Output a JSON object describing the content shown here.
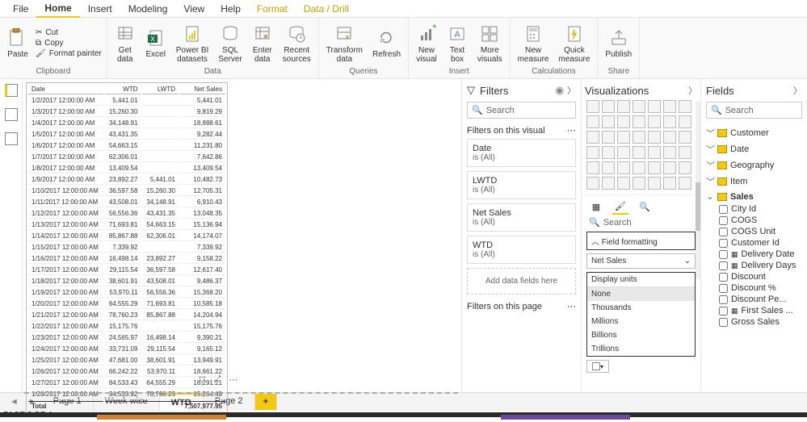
{
  "menubar": [
    "File",
    "Home",
    "Insert",
    "Modeling",
    "View",
    "Help",
    "Format",
    "Data / Drill"
  ],
  "menubar_active": 1,
  "menubar_yellow": [
    6,
    7
  ],
  "ribbon": {
    "clipboard": {
      "label": "Clipboard",
      "paste": "Paste",
      "cut": "Cut",
      "copy": "Copy",
      "fmtpainter": "Format painter"
    },
    "data": {
      "label": "Data",
      "get": "Get\ndata",
      "excel": "Excel",
      "pbi": "Power BI\ndatasets",
      "sql": "SQL\nServer",
      "enter": "Enter\ndata",
      "recent": "Recent\nsources"
    },
    "queries": {
      "label": "Queries",
      "transform": "Transform\ndata",
      "refresh": "Refresh"
    },
    "insert": {
      "label": "Insert",
      "newvis": "New\nvisual",
      "textbox": "Text\nbox",
      "more": "More\nvisuals"
    },
    "calc": {
      "label": "Calculations",
      "newmeas": "New\nmeasure",
      "quick": "Quick\nmeasure"
    },
    "share": {
      "label": "Share",
      "publish": "Publish"
    }
  },
  "table": {
    "columns": [
      "Date",
      "WTD",
      "LWTD",
      "Net Sales"
    ],
    "rows": [
      [
        "1/2/2017 12:00:00 AM",
        "5,441.01",
        "",
        "5,441.01"
      ],
      [
        "1/3/2017 12:00:00 AM",
        "15,260.30",
        "",
        "9,819.29"
      ],
      [
        "1/4/2017 12:00:00 AM",
        "34,148.91",
        "",
        "18,888.61"
      ],
      [
        "1/5/2017 12:00:00 AM",
        "43,431.35",
        "",
        "9,282.44"
      ],
      [
        "1/6/2017 12:00:00 AM",
        "54,663.15",
        "",
        "11,231.80"
      ],
      [
        "1/7/2017 12:00:00 AM",
        "62,306.01",
        "",
        "7,642.86"
      ],
      [
        "1/8/2017 12:00:00 AM",
        "13,409.54",
        "",
        "13,409.54"
      ],
      [
        "1/9/2017 12:00:00 AM",
        "23,892.27",
        "5,441.01",
        "10,482.73"
      ],
      [
        "1/10/2017 12:00:00 AM",
        "36,597.58",
        "15,260.30",
        "12,705.31"
      ],
      [
        "1/11/2017 12:00:00 AM",
        "43,508.01",
        "34,148.91",
        "6,910.43"
      ],
      [
        "1/12/2017 12:00:00 AM",
        "56,556.36",
        "43,431.35",
        "13,048.35"
      ],
      [
        "1/13/2017 12:00:00 AM",
        "71,693.81",
        "54,663.15",
        "15,136.94"
      ],
      [
        "1/14/2017 12:00:00 AM",
        "85,867.88",
        "62,306.01",
        "14,174.07"
      ],
      [
        "1/15/2017 12:00:00 AM",
        "7,339.92",
        "",
        "7,339.92"
      ],
      [
        "1/16/2017 12:00:00 AM",
        "16,498.14",
        "23,892.27",
        "9,158.22"
      ],
      [
        "1/17/2017 12:00:00 AM",
        "29,115.54",
        "36,597.58",
        "12,617.40"
      ],
      [
        "1/18/2017 12:00:00 AM",
        "38,601.91",
        "43,508.01",
        "9,486.37"
      ],
      [
        "1/19/2017 12:00:00 AM",
        "53,970.11",
        "56,556.36",
        "15,368.20"
      ],
      [
        "1/20/2017 12:00:00 AM",
        "64,555.29",
        "71,693.81",
        "10,585.18"
      ],
      [
        "1/21/2017 12:00:00 AM",
        "78,760.23",
        "85,867.88",
        "14,204.94"
      ],
      [
        "1/22/2017 12:00:00 AM",
        "15,175.76",
        "",
        "15,175.76"
      ],
      [
        "1/23/2017 12:00:00 AM",
        "24,565.97",
        "16,498.14",
        "9,390.21"
      ],
      [
        "1/24/2017 12:00:00 AM",
        "33,731.09",
        "29,115.54",
        "9,165.12"
      ],
      [
        "1/25/2017 12:00:00 AM",
        "47,681.00",
        "38,601.91",
        "13,949.91"
      ],
      [
        "1/26/2017 12:00:00 AM",
        "66,242.22",
        "53,970.11",
        "18,661.22"
      ],
      [
        "1/27/2017 12:00:00 AM",
        "84,533.43",
        "64,555.29",
        "18,291.21"
      ],
      [
        "1/28/2017 12:00:00 AM",
        "94,533.92",
        "78,760.23",
        "15,264.49"
      ]
    ],
    "total_label": "Total",
    "total_value": "7,507,977.95"
  },
  "filters": {
    "title": "Filters",
    "search": "Search",
    "on_visual": "Filters on this visual",
    "on_page": "Filters on this page",
    "cards": [
      {
        "name": "Date",
        "val": "is (All)"
      },
      {
        "name": "LWTD",
        "val": "is (All)"
      },
      {
        "name": "Net Sales",
        "val": "is (All)"
      },
      {
        "name": "WTD",
        "val": "is (All)"
      }
    ],
    "add": "Add data fields here"
  },
  "viz": {
    "title": "Visualizations",
    "search": "Search",
    "format_section": "Field formatting",
    "select_value": "Net Sales",
    "display_units": "Display units",
    "options": [
      "None",
      "Thousands",
      "Millions",
      "Billions",
      "Trillions"
    ]
  },
  "fields": {
    "title": "Fields",
    "search": "Search",
    "tables": [
      "Customer",
      "Date",
      "Geography",
      "Item",
      "Sales"
    ],
    "sales_children": [
      "City Id",
      "COGS",
      "COGS Unit",
      "Customer Id",
      "Delivery Date",
      "Delivery Days",
      "Discount",
      "Discount %",
      "Discount Pe...",
      "First Sales ...",
      "Gross Sales"
    ],
    "date_idx": [
      4,
      5,
      9
    ]
  },
  "pagetabs": [
    "Page 1",
    "Week wise",
    "WTD",
    "Page 2"
  ],
  "active_page": 2,
  "status": "PAGE 3 OF 4"
}
